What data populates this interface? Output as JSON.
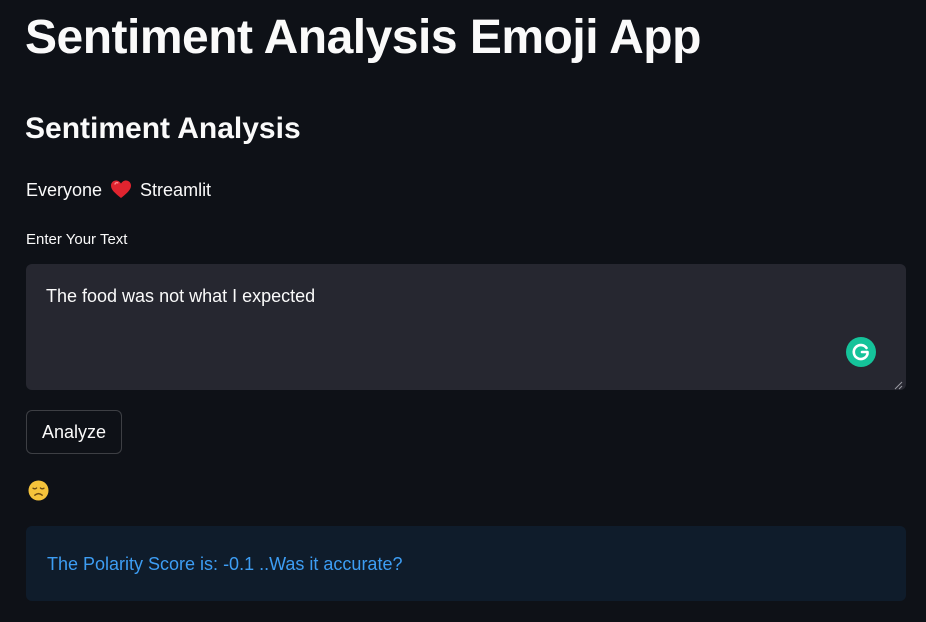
{
  "app": {
    "title": "Sentiment Analysis Emoji App",
    "subtitle": "Sentiment Analysis",
    "tagline": {
      "before": "Everyone",
      "icon": "red-heart-emoji",
      "after": "Streamlit"
    }
  },
  "input": {
    "label": "Enter Your Text",
    "value": "The food was not what I expected",
    "assistant_icon": "grammarly-icon"
  },
  "actions": {
    "analyze_label": "Analyze"
  },
  "result": {
    "emoji": "disappointed-face-emoji",
    "message": "The Polarity Score is: -0.1 ..Was it accurate?"
  },
  "colors": {
    "background": "#0e1117",
    "text": "#fafafa",
    "input_bg": "#262730",
    "info_text": "#3d9df3",
    "heart": "#e0242f",
    "grammarly": "#15c39a"
  }
}
